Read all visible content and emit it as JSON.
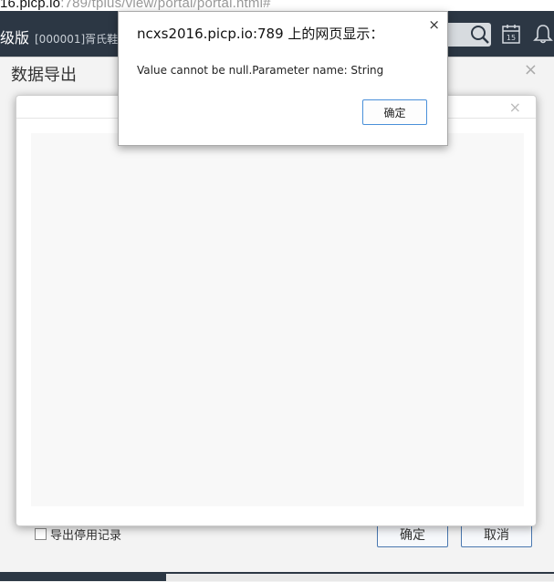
{
  "browser": {
    "url_host": "16.picp.io",
    "url_path": ":789/tplus/view/portal/portal.html#"
  },
  "appbar": {
    "title": "级版",
    "company": "[000001]胥氏鞋行",
    "calendar_day": "15",
    "icons": [
      "search-icon",
      "calendar-icon",
      "bell-icon"
    ]
  },
  "export_dialog": {
    "title": "数据导出",
    "close": "×",
    "checkbox_label": "导出停用记录",
    "ok_label": "确定",
    "cancel_label": "取消"
  },
  "inner_modal": {
    "close": "×"
  },
  "alert": {
    "title": "ncxs2016.picp.io:789 上的网页显示：",
    "message": "Value cannot be null.Parameter name: String",
    "ok_label": "确定",
    "close": "×"
  },
  "colors": {
    "header_bg": "#2c3744",
    "button_border": "#4a78b0",
    "alert_ok_border": "#4a90d9"
  }
}
